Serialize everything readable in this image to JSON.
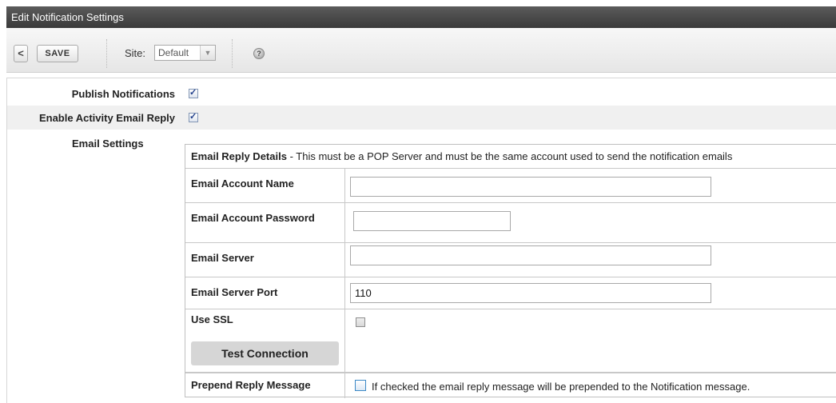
{
  "window": {
    "title": "Edit Notification Settings"
  },
  "toolbar": {
    "back_glyph": "<",
    "save_label": "SAVE",
    "site_label": "Site:",
    "site_value": "Default",
    "help_glyph": "?"
  },
  "form": {
    "publish_label": "Publish Notifications",
    "publish_checked": true,
    "reply_label": "Enable Activity Email Reply",
    "reply_checked": true,
    "email_settings_label": "Email Settings"
  },
  "details": {
    "header_bold": "Email Reply Details",
    "header_rest": " - This must be a POP Server and must be the same account used to send the notification emails",
    "account_name_label": "Email Account Name",
    "account_name_value": "",
    "password_label": "Email Account Password",
    "password_value": "",
    "server_label": "Email Server",
    "server_value": "",
    "port_label": "Email Server Port",
    "port_value": "110",
    "ssl_label": "Use SSL",
    "ssl_checked": false,
    "test_button": "Test Connection",
    "prepend_label": "Prepend Reply Message",
    "prepend_checked": false,
    "prepend_text": "If checked the email reply message will be prepended to the Notification message."
  }
}
